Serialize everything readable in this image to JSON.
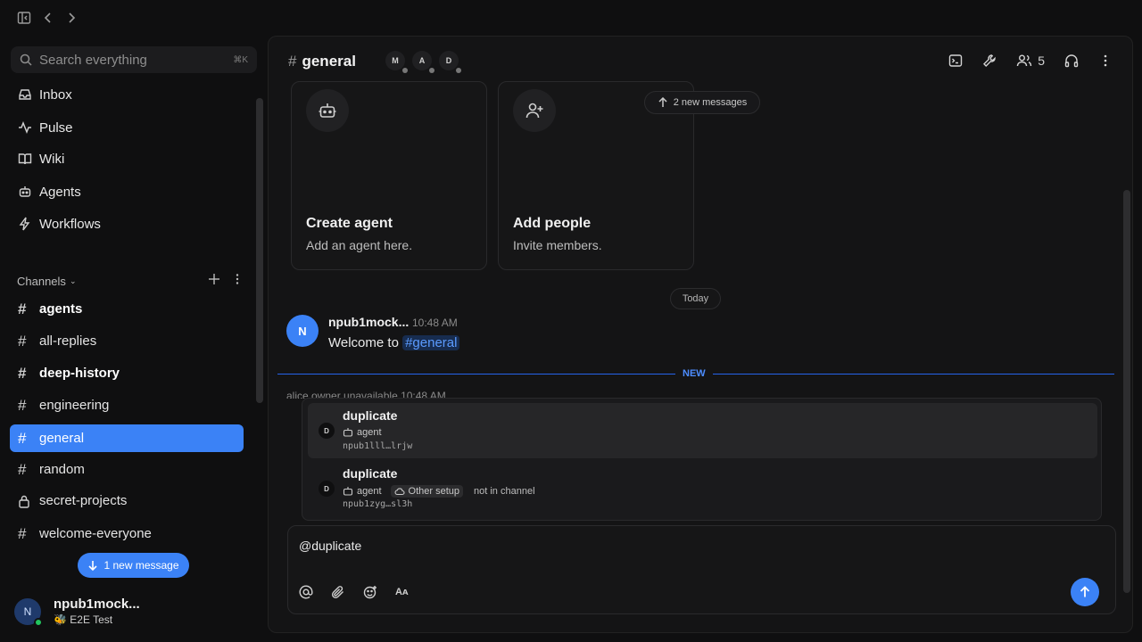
{
  "topbar": {
    "toggle_sidebar_icon": "sidebar-toggle-icon",
    "back_icon": "chevron-left-icon",
    "forward_icon": "chevron-right-icon"
  },
  "sidebar": {
    "search": {
      "placeholder": "Search everything",
      "shortcut": "⌘K"
    },
    "nav": [
      {
        "label": "Inbox",
        "icon": "inbox-icon"
      },
      {
        "label": "Pulse",
        "icon": "pulse-icon"
      },
      {
        "label": "Wiki",
        "icon": "book-icon"
      },
      {
        "label": "Agents",
        "icon": "bot-icon"
      },
      {
        "label": "Workflows",
        "icon": "bolt-icon"
      }
    ],
    "channels_header": "Channels",
    "channels": [
      {
        "name": "agents",
        "unread": true,
        "private": false
      },
      {
        "name": "all-replies",
        "unread": false,
        "private": false
      },
      {
        "name": "deep-history",
        "unread": true,
        "private": false
      },
      {
        "name": "engineering",
        "unread": false,
        "private": false
      },
      {
        "name": "general",
        "unread": false,
        "private": false,
        "active": true
      },
      {
        "name": "random",
        "unread": false,
        "private": false
      },
      {
        "name": "secret-projects",
        "unread": false,
        "private": true
      },
      {
        "name": "welcome-everyone",
        "unread": false,
        "private": false
      }
    ],
    "new_message_pill": "1 new message",
    "user": {
      "initial": "N",
      "name": "npub1mock...",
      "status": "E2E Test",
      "status_emoji": "🐝"
    }
  },
  "channel": {
    "name": "general",
    "member_avatars": [
      "M",
      "A",
      "D"
    ],
    "member_count": "5"
  },
  "cards": [
    {
      "title": "Create agent",
      "subtitle": "Add an agent here.",
      "icon": "bot-icon"
    },
    {
      "title": "Add people",
      "subtitle": "Invite members.",
      "icon": "user-plus-icon"
    }
  ],
  "new_messages_indicator": "2 new messages",
  "date_divider": "Today",
  "messages": [
    {
      "initial": "N",
      "author": "npub1mock...",
      "time": "10:48 AM",
      "text": "Welcome to ",
      "mention": "#general"
    }
  ],
  "new_divider_label": "NEW",
  "ghost_message": "alice  owner unavailable  10:48 AM",
  "mention_popup": {
    "options": [
      {
        "initial": "D",
        "name": "duplicate",
        "kind": "agent",
        "key": "npub1lll…lrjw",
        "badge": "",
        "note": ""
      },
      {
        "initial": "D",
        "name": "duplicate",
        "kind": "agent",
        "key": "npub1zyg…sl3h",
        "badge": "Other setup",
        "note": "not in channel"
      }
    ]
  },
  "composer": {
    "value": "@duplicate"
  },
  "colors": {
    "accent": "#3b82f6",
    "background": "#0f0f10",
    "panel": "#141415"
  }
}
